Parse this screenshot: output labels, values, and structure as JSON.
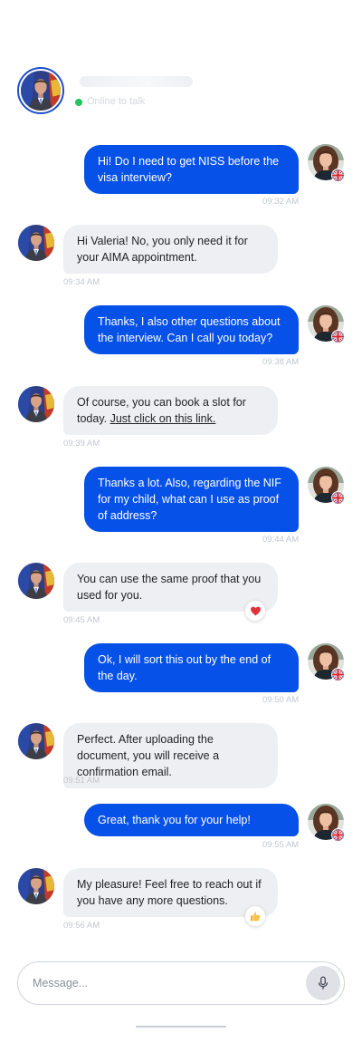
{
  "header": {
    "status_text": "Online to talk"
  },
  "composer": {
    "placeholder": "Message..."
  },
  "messages": [
    {
      "from": "user",
      "text": "Hi! Do I need to get NISS before the visa interview?",
      "time": "09:32 AM"
    },
    {
      "from": "agent",
      "text": "Hi Valeria! No, you only need it for your AIMA appointment.",
      "time": "09:34 AM"
    },
    {
      "from": "user",
      "text": "Thanks, I also other questions about the interview. Can I call you today?",
      "time": "09:38 AM"
    },
    {
      "from": "agent",
      "text": "Of course, you can book a slot for today.",
      "link": "Just click on this link.",
      "time": "09:39 AM"
    },
    {
      "from": "user",
      "text": "Thanks a lot. Also, regarding the NIF for my child, what can I use as proof of address?",
      "time": "09:44 AM"
    },
    {
      "from": "agent",
      "text": "You can use the same proof that you used for you.",
      "time": "09:45 AM",
      "reaction": "heart-icon"
    },
    {
      "from": "user",
      "text": "Ok, I will sort this out by the end of the day.",
      "time": "09:50 AM"
    },
    {
      "from": "agent",
      "text": "Perfect. After uploading the document, you will receive a confirmation email.",
      "time": "09:51 AM"
    },
    {
      "from": "user",
      "text": "Great, thank you for your help!",
      "time": "09:55 AM"
    },
    {
      "from": "agent",
      "text": "My pleasure! Feel free to reach out if you have any more questions.",
      "time": "09:56 AM",
      "reaction": "thumbs-up-icon"
    }
  ],
  "colors": {
    "outgoing_bubble": "#0651e8",
    "incoming_bubble": "#eeeff2",
    "online": "#21c45d"
  }
}
